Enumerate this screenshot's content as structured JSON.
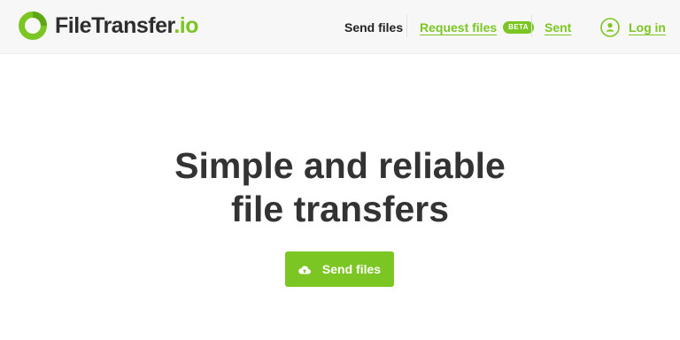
{
  "brand": {
    "name_main": "FileTransfer",
    "name_suffix": ".io"
  },
  "nav": {
    "send_files": "Send files",
    "request_files": "Request files",
    "beta_badge": "BETA",
    "sent": "Sent",
    "login": "Log in"
  },
  "hero": {
    "title_line1": "Simple and reliable",
    "title_line2": "file transfers"
  },
  "cta": {
    "label": "Send files",
    "icon": "cloud-upload-icon"
  },
  "colors": {
    "accent": "#7cc623",
    "text": "#333333",
    "header_bg": "#f7f7f7"
  }
}
